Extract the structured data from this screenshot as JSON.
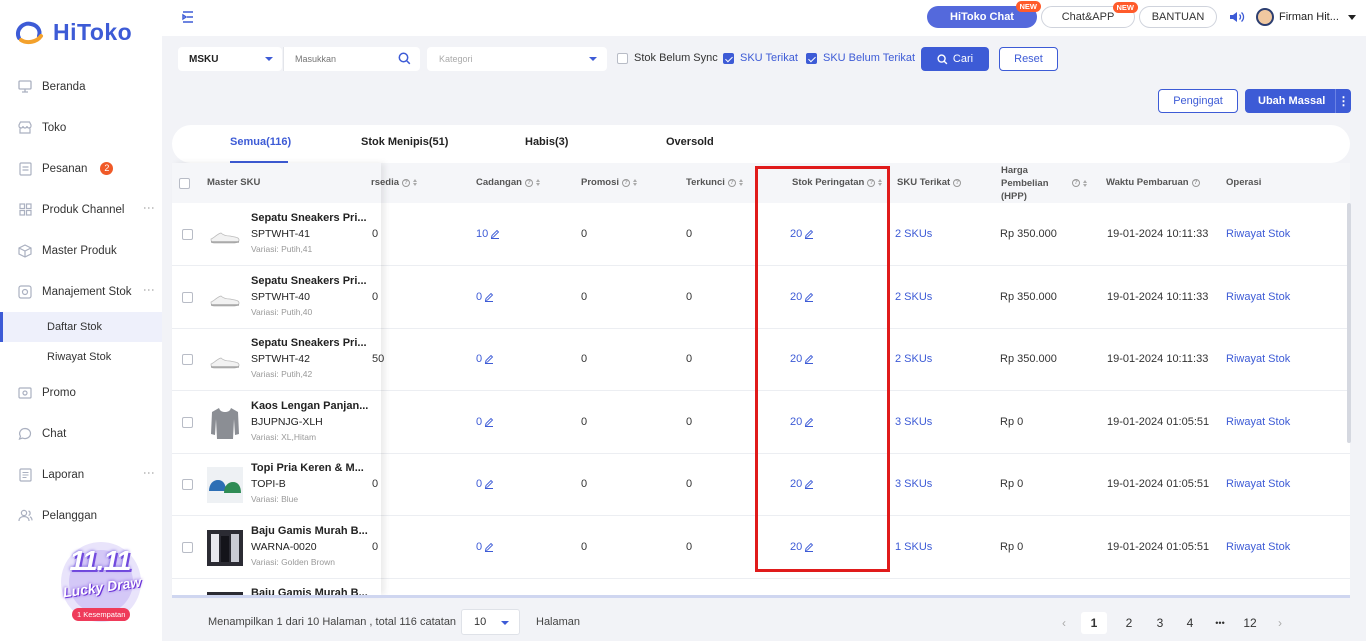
{
  "brand": {
    "name": "HiToko",
    "accent": "#3d5bd6"
  },
  "sidebar": {
    "items": [
      {
        "label": "Beranda",
        "icon": "monitor-icon"
      },
      {
        "label": "Toko",
        "icon": "store-icon"
      },
      {
        "label": "Pesanan",
        "icon": "orders-icon",
        "badge": "2"
      },
      {
        "label": "Produk Channel",
        "icon": "grid-icon"
      },
      {
        "label": "Master Produk",
        "icon": "box-icon"
      },
      {
        "label": "Manajement Stok",
        "icon": "stock-icon"
      }
    ],
    "stock_sub": [
      {
        "label": "Daftar Stok"
      },
      {
        "label": "Riwayat Stok"
      }
    ],
    "items2": [
      {
        "label": "Promo",
        "icon": "promo-icon"
      },
      {
        "label": "Chat",
        "icon": "chat-icon"
      },
      {
        "label": "Laporan",
        "icon": "report-icon"
      },
      {
        "label": "Pelanggan",
        "icon": "users-icon"
      }
    ],
    "promo": {
      "title": "11.11",
      "subtitle": "Lucky Draw",
      "chance": "1 Kesempatan"
    }
  },
  "topbar": {
    "hitoko_chat": "HiToko Chat",
    "chat_app": "Chat&APP",
    "new_tag": "NEW",
    "bantuan": "BANTUAN",
    "user": "Firman Hit..."
  },
  "filters": {
    "field_select": "MSKU",
    "search_placeholder": "Masukkan",
    "category_placeholder": "Kategori",
    "stok_belum_sync": "Stok Belum Sync",
    "sku_terikat": "SKU Terikat",
    "sku_belum_terikat": "SKU Belum Terikat",
    "cari": "Cari",
    "reset": "Reset"
  },
  "actions": {
    "pengingat": "Pengingat",
    "ubah_massal": "Ubah Massal"
  },
  "tabs": [
    {
      "label": "Semua(116)"
    },
    {
      "label": "Stok Menipis(51)"
    },
    {
      "label": "Habis(3)"
    },
    {
      "label": "Oversold"
    }
  ],
  "columns": {
    "master_sku": "Master SKU",
    "tersedia": "rsedia",
    "cadangan": "Cadangan",
    "promosi": "Promosi",
    "terkunci": "Terkunci",
    "stok_peringatan": "Stok Peringatan",
    "sku_terikat": "SKU Terikat",
    "harga_1": "Harga",
    "harga_2": "Pembelian",
    "harga_3": "(HPP)",
    "waktu": "Waktu Pembaruan",
    "operasi": "Operasi"
  },
  "rows": [
    {
      "name": "Sepatu Sneakers Pri...",
      "sku": "SPTWHT-41",
      "variant": "Variasi: Putih,41",
      "tersedia": "0",
      "cadangan": "10",
      "promosi": "0",
      "terkunci": "0",
      "peringatan": "20",
      "sku_terikat": "2 SKUs",
      "harga": "Rp 350.000",
      "waktu": "19-01-2024 10:11:33",
      "operasi": "Riwayat Stok",
      "thumb": "shoe"
    },
    {
      "name": "Sepatu Sneakers Pri...",
      "sku": "SPTWHT-40",
      "variant": "Variasi: Putih,40",
      "tersedia": "0",
      "cadangan": "0",
      "promosi": "0",
      "terkunci": "0",
      "peringatan": "20",
      "sku_terikat": "2 SKUs",
      "harga": "Rp 350.000",
      "waktu": "19-01-2024 10:11:33",
      "operasi": "Riwayat Stok",
      "thumb": "shoe"
    },
    {
      "name": "Sepatu Sneakers Pri...",
      "sku": "SPTWHT-42",
      "variant": "Variasi: Putih,42",
      "tersedia": "50",
      "cadangan": "0",
      "promosi": "0",
      "terkunci": "0",
      "peringatan": "20",
      "sku_terikat": "2 SKUs",
      "harga": "Rp 350.000",
      "waktu": "19-01-2024 10:11:33",
      "operasi": "Riwayat Stok",
      "thumb": "shoe"
    },
    {
      "name": "Kaos Lengan Panjan...",
      "sku": "BJUPNJG-XLH",
      "variant": "Variasi: XL,Hitam",
      "tersedia": "",
      "cadangan": "0",
      "promosi": "0",
      "terkunci": "0",
      "peringatan": "20",
      "sku_terikat": "3 SKUs",
      "harga": "Rp 0",
      "waktu": "19-01-2024 01:05:51",
      "operasi": "Riwayat Stok",
      "thumb": "shirt"
    },
    {
      "name": "Topi Pria Keren & M...",
      "sku": "TOPI-B",
      "variant": "Variasi: Blue",
      "tersedia": "0",
      "cadangan": "0",
      "promosi": "0",
      "terkunci": "0",
      "peringatan": "20",
      "sku_terikat": "3 SKUs",
      "harga": "Rp 0",
      "waktu": "19-01-2024 01:05:51",
      "operasi": "Riwayat Stok",
      "thumb": "cap"
    },
    {
      "name": "Baju Gamis Murah B...",
      "sku": "WARNA-0020",
      "variant": "Variasi: Golden Brown",
      "tersedia": "0",
      "cadangan": "0",
      "promosi": "0",
      "terkunci": "0",
      "peringatan": "20",
      "sku_terikat": "1 SKUs",
      "harga": "Rp 0",
      "waktu": "19-01-2024 01:05:51",
      "operasi": "Riwayat Stok",
      "thumb": "gamis"
    },
    {
      "name": "Baju Gamis Murah B...",
      "sku": "",
      "variant": "",
      "tersedia": "",
      "cadangan": "",
      "promosi": "",
      "terkunci": "",
      "peringatan": "",
      "sku_terikat": "",
      "harga": "",
      "waktu": "",
      "operasi": "",
      "thumb": "gamis"
    }
  ],
  "pager": {
    "summary": "Menampilkan 1 dari 10 Halaman , total 116 catatan",
    "page_size": "10",
    "halaman": "Halaman",
    "pages": [
      "1",
      "2",
      "3",
      "4",
      "•••",
      "12"
    ],
    "current": "1"
  }
}
